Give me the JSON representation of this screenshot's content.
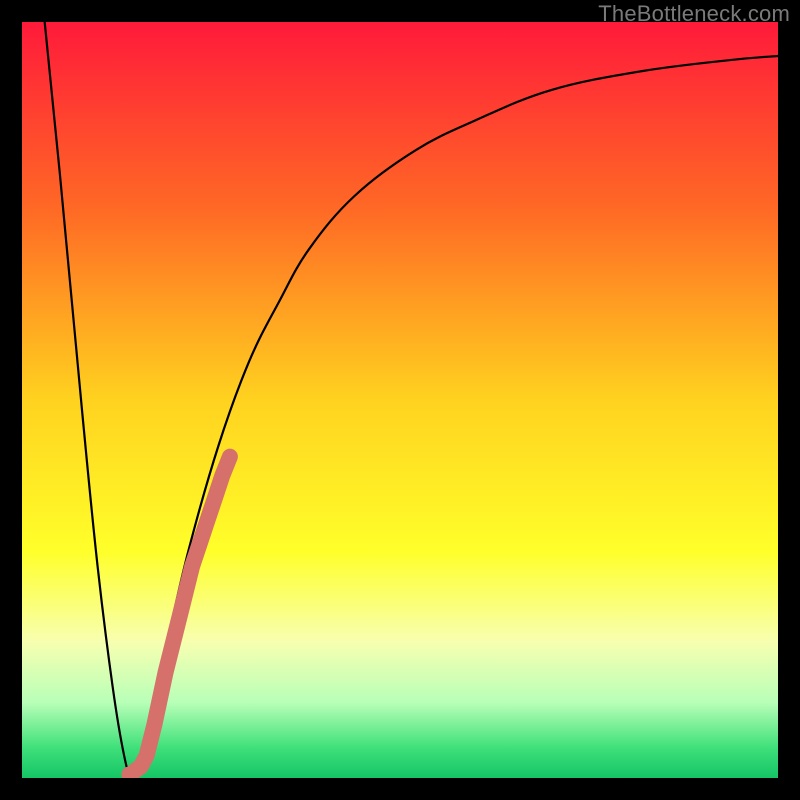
{
  "watermark": "TheBottleneck.com",
  "colors": {
    "frame": "#000000",
    "curve": "#000000",
    "marker": "#d6706b",
    "gradient_stops": [
      {
        "offset": 0.0,
        "color": "#ff1a3a"
      },
      {
        "offset": 0.25,
        "color": "#ff6a25"
      },
      {
        "offset": 0.5,
        "color": "#ffd21f"
      },
      {
        "offset": 0.7,
        "color": "#ffff2a"
      },
      {
        "offset": 0.82,
        "color": "#f7ffb0"
      },
      {
        "offset": 0.9,
        "color": "#b8ffb8"
      },
      {
        "offset": 0.96,
        "color": "#3fe07a"
      },
      {
        "offset": 1.0,
        "color": "#15c566"
      }
    ]
  },
  "chart_data": {
    "type": "line",
    "title": "",
    "xlabel": "",
    "ylabel": "",
    "xlim": [
      0,
      100
    ],
    "ylim": [
      0,
      100
    ],
    "series": [
      {
        "name": "bottleneck-curve",
        "x": [
          3,
          5,
          8,
          10,
          12,
          13.5,
          14.5,
          15.5,
          17,
          19,
          22,
          26,
          30,
          34,
          38,
          44,
          52,
          60,
          70,
          82,
          94,
          100
        ],
        "values": [
          100,
          80,
          48,
          28,
          12,
          3,
          0,
          2,
          8,
          17,
          30,
          44,
          55,
          63,
          70,
          77,
          83,
          87,
          91,
          93.5,
          95,
          95.5
        ]
      }
    ],
    "markers": [
      {
        "name": "highlight-segment",
        "x": [
          15.0,
          15.7,
          16.5,
          17.5,
          19.0,
          21.0,
          22.5,
          23.5,
          24.5,
          25.5,
          26.5,
          27.5
        ],
        "values": [
          1.0,
          1.5,
          3.0,
          7.0,
          14.0,
          22.0,
          28.0,
          31.0,
          34.0,
          37.0,
          40.0,
          42.5
        ]
      }
    ]
  }
}
